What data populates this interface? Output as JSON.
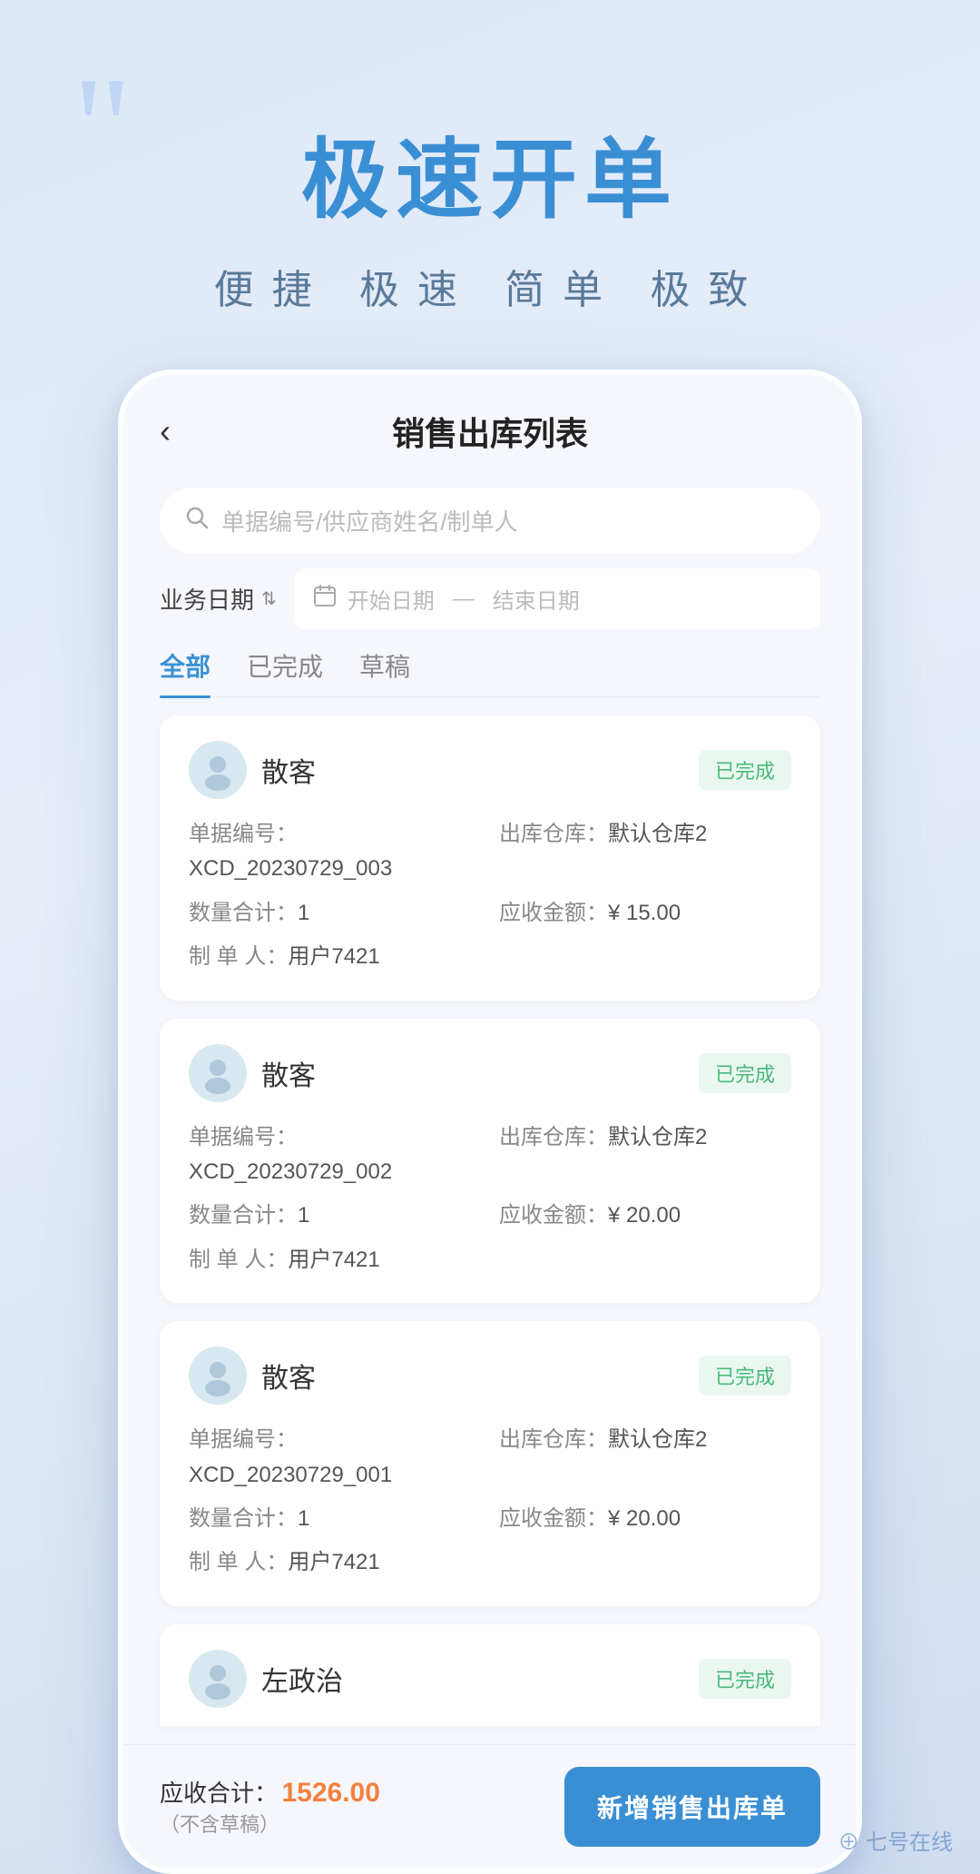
{
  "hero": {
    "quote_mark": "““",
    "title": "极速开单",
    "subtitle": "便捷  极速  简单  极致"
  },
  "app": {
    "header": {
      "back_label": "‹",
      "title": "销售出库列表"
    },
    "search": {
      "placeholder": "单据编号/供应商姓名/制单人"
    },
    "date_filter": {
      "label": "业务日期",
      "start_placeholder": "开始日期",
      "dash": "—",
      "end_placeholder": "结束日期"
    },
    "tabs": [
      {
        "label": "全部",
        "active": true
      },
      {
        "label": "已完成",
        "active": false
      },
      {
        "label": "草稿",
        "active": false
      }
    ],
    "orders": [
      {
        "customer": "散客",
        "status": "已完成",
        "doc_no_label": "单据编号：",
        "doc_no": "XCD_20230729_003",
        "warehouse_label": "出库仓库：",
        "warehouse": "默认仓库2",
        "qty_label": "数量合计：",
        "qty": "1",
        "amount_label": "应收金额：",
        "amount": "¥ 15.00",
        "maker_label": "制 单 人：",
        "maker": "用户7421"
      },
      {
        "customer": "散客",
        "status": "已完成",
        "doc_no_label": "单据编号：",
        "doc_no": "XCD_20230729_002",
        "warehouse_label": "出库仓库：",
        "warehouse": "默认仓库2",
        "qty_label": "数量合计：",
        "qty": "1",
        "amount_label": "应收金额：",
        "amount": "¥ 20.00",
        "maker_label": "制 单 人：",
        "maker": "用户7421"
      },
      {
        "customer": "散客",
        "status": "已完成",
        "doc_no_label": "单据编号：",
        "doc_no": "XCD_20230729_001",
        "warehouse_label": "出库仓库：",
        "warehouse": "默认仓库2",
        "qty_label": "数量合计：",
        "qty": "1",
        "amount_label": "应收金额：",
        "amount": "¥ 20.00",
        "maker_label": "制 单 人：",
        "maker": "用户7421"
      }
    ],
    "partial_order": {
      "customer": "左政治",
      "status": "已完成"
    },
    "bottom": {
      "receivable_label": "应收合计：",
      "receivable_amount": "1526.00",
      "note": "（不含草稿）",
      "add_btn": "新增销售出库单"
    }
  },
  "watermark": "⊕ 七号在线"
}
